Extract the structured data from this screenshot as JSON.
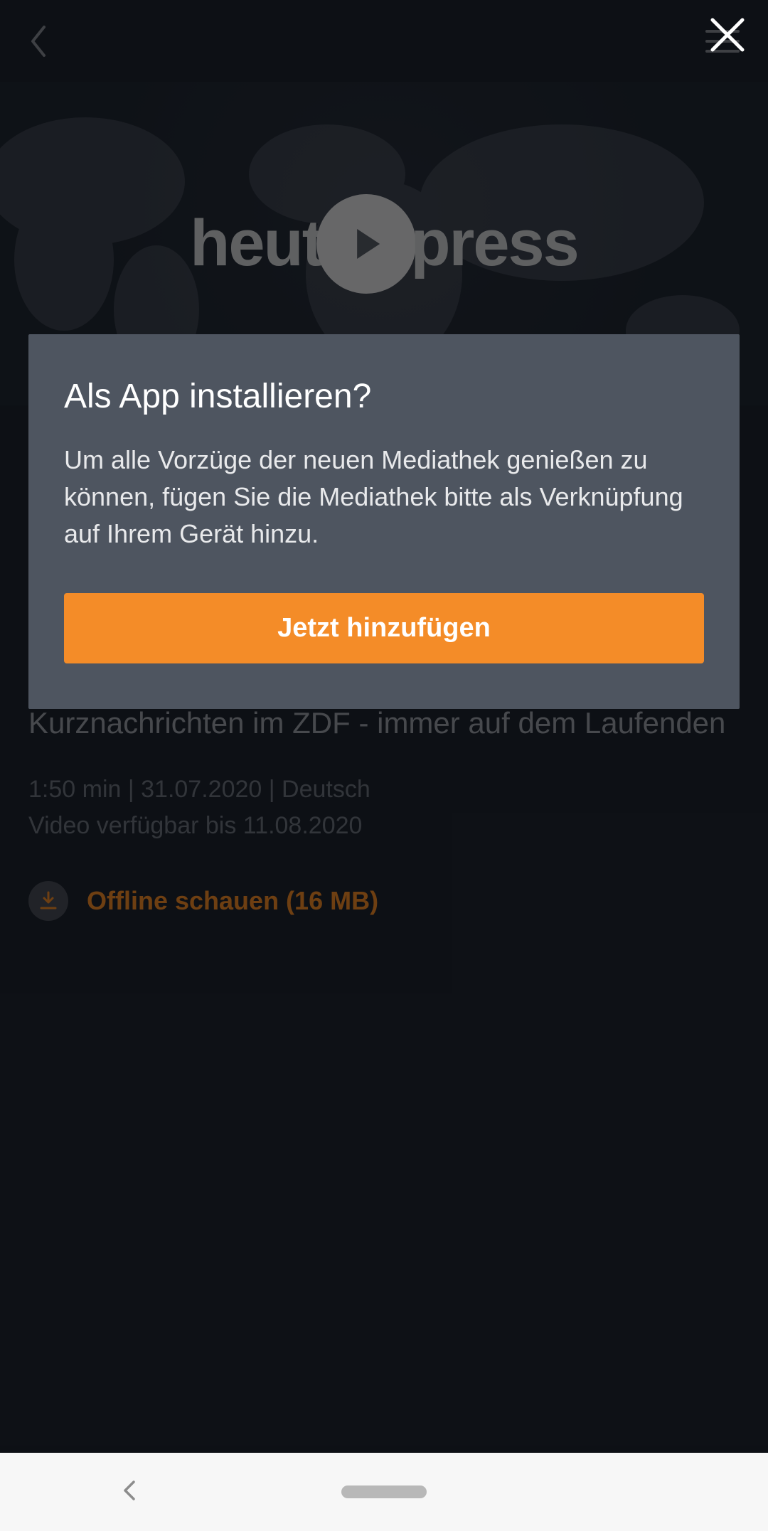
{
  "hero": {
    "logo_left": "heut",
    "logo_right": "press"
  },
  "content": {
    "subtitle": "Kurznachrichten im ZDF - immer auf dem Laufenden",
    "meta_line1": "1:50 min | 31.07.2020 | Deutsch",
    "meta_line2": "Video verfügbar bis 11.08.2020",
    "offline_label": "Offline schauen (16 MB)"
  },
  "modal": {
    "title": "Als App installieren?",
    "body": "Um alle Vorzüge der neuen Mediathek genießen zu können, fügen Sie die Mediathek bitte als Verknüpfung auf Ihrem Gerät hinzu.",
    "cta": "Jetzt hinzufügen"
  },
  "colors": {
    "accent": "#f48c28"
  }
}
